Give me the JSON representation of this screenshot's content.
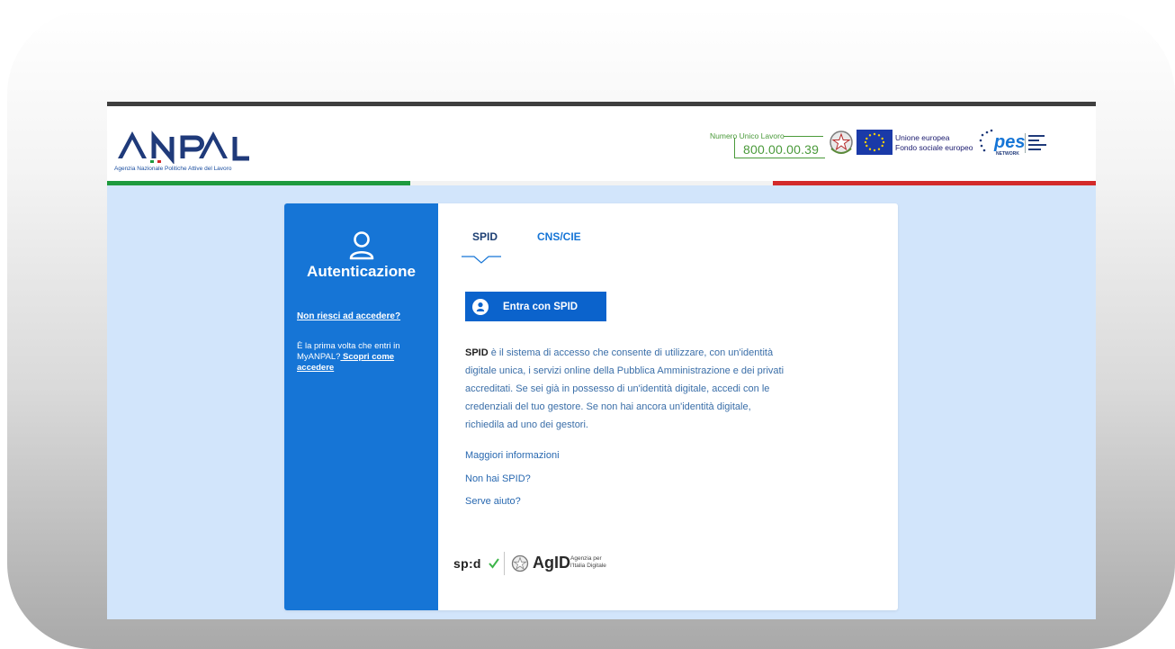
{
  "header": {
    "logo_text": "ANPAL",
    "tagline": "Agenzia Nazionale Politiche Attive del Lavoro",
    "hotline_label": "Numero Unico Lavoro",
    "hotline_number": "800.00.00.39",
    "eu_line1": "Unione europea",
    "eu_line2": "Fondo sociale europeo",
    "pes_logo_text": "pes",
    "pes_network": "NETWORK"
  },
  "sidebar": {
    "title": "Autenticazione",
    "help_link": "Non riesci ad accedere?",
    "first_time_text": "È la prima volta che entri in MyANPAL?",
    "first_time_link": " Scopri come accedere"
  },
  "tabs": [
    {
      "label": "SPID",
      "active": true
    },
    {
      "label": "CNS/CIE",
      "active": false
    }
  ],
  "login": {
    "spid_button_label": "Entra con SPID",
    "description_bold": "SPID",
    "description_rest": " è il sistema di accesso che consente di utilizzare, con un'identità digitale unica, i servizi online della Pubblica Amministrazione e dei privati accreditati. Se sei già in possesso di un'identità digitale, accedi con le credenziali del tuo gestore. Se non hai ancora un'identità digitale, richiedila ad uno dei gestori.",
    "links": [
      "Maggiori informazioni",
      "Non hai SPID?",
      "Serve aiuto?"
    ]
  },
  "footer": {
    "spid_logo_text": "sp:d",
    "agid_logo_text": "AgID",
    "agid_sub_line1": "Agenzia per",
    "agid_sub_line2": "l'Italia Digitale"
  },
  "colors": {
    "sidebar_blue": "#1675d6",
    "button_blue": "#0b63cc",
    "page_bg": "#d2e5fb",
    "flag_green": "#1e9a3e",
    "flag_red": "#d32a2a",
    "hotline_green": "#4a9a3a"
  }
}
